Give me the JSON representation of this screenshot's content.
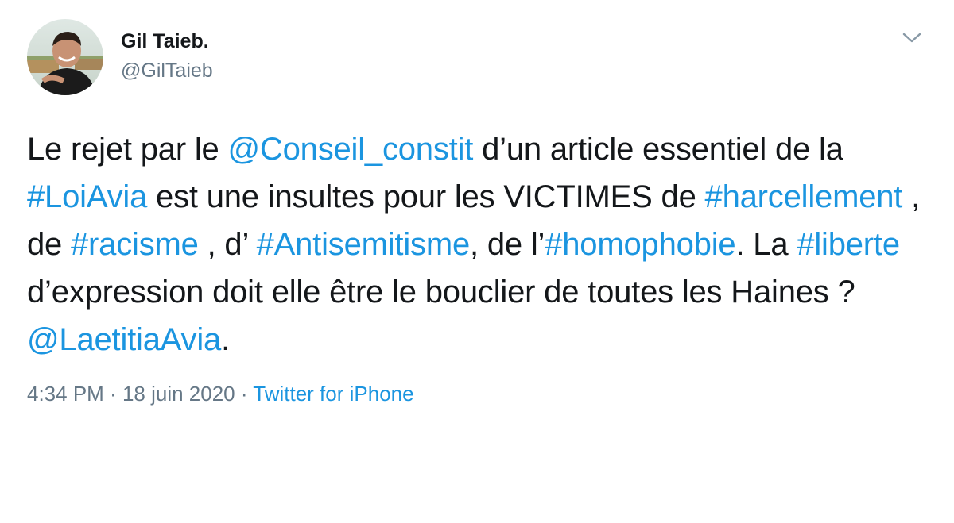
{
  "author": {
    "display_name": "Gil Taieb.",
    "handle": "@GilTaieb"
  },
  "tweet": {
    "segments": [
      {
        "text": "Le rejet par le ",
        "type": "text"
      },
      {
        "text": "@Conseil_constit",
        "type": "mention"
      },
      {
        "text": " d’un article essentiel de la ",
        "type": "text"
      },
      {
        "text": "#LoiAvia",
        "type": "hashtag"
      },
      {
        "text": " est une insultes pour les VICTIMES de ",
        "type": "text"
      },
      {
        "text": "#harcellement",
        "type": "hashtag"
      },
      {
        "text": " , de ",
        "type": "text"
      },
      {
        "text": "#racisme",
        "type": "hashtag"
      },
      {
        "text": " , d’ ",
        "type": "text"
      },
      {
        "text": "#Antisemitisme",
        "type": "hashtag"
      },
      {
        "text": ", de l’",
        "type": "text"
      },
      {
        "text": "#homophobie",
        "type": "hashtag"
      },
      {
        "text": ". La ",
        "type": "text"
      },
      {
        "text": "#liberte",
        "type": "hashtag"
      },
      {
        "text": " d’expression doit elle être le bouclier de toutes les Haines ? ",
        "type": "text"
      },
      {
        "text": "@LaetitiaAvia",
        "type": "mention"
      },
      {
        "text": ".",
        "type": "text"
      }
    ]
  },
  "meta": {
    "time": "4:34 PM",
    "separator1": " · ",
    "date": "18 juin 2020",
    "separator2": " · ",
    "source": "Twitter for iPhone"
  },
  "icons": {
    "caret": "chevron-down-icon",
    "avatar": "profile-photo"
  },
  "colors": {
    "link": "#1b95e0",
    "text": "#14171a",
    "secondary": "#657786"
  }
}
